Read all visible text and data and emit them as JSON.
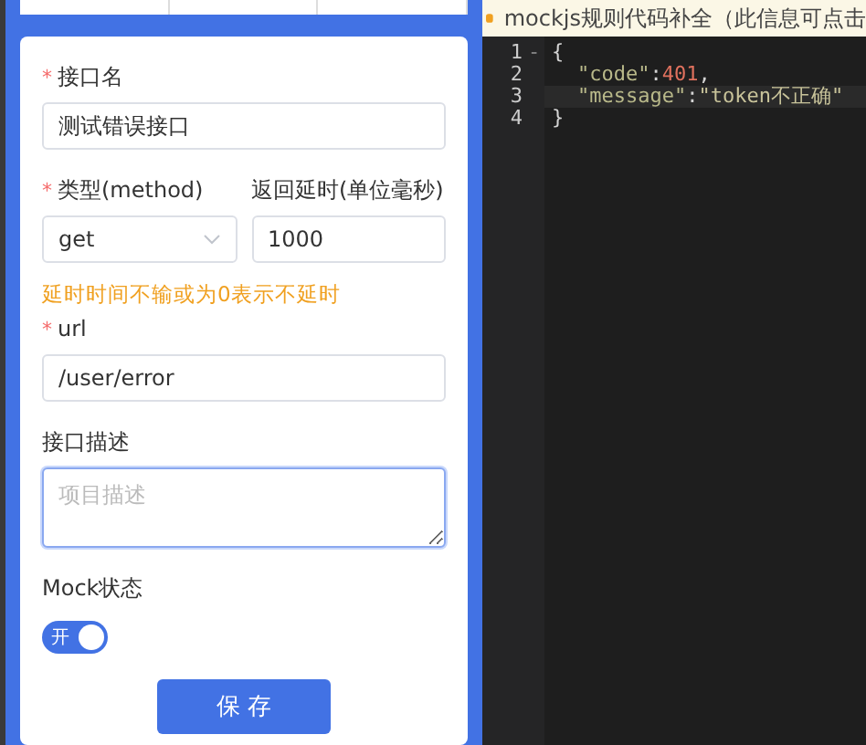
{
  "form": {
    "name": {
      "required_mark": "*",
      "label": "接口名",
      "value": "测试错误接口"
    },
    "method": {
      "required_mark": "*",
      "label": "类型(method)",
      "value": "get"
    },
    "delay": {
      "label": "返回延时(单位毫秒)",
      "value": "1000"
    },
    "hint": "延时时间不输或为0表示不延时",
    "url": {
      "required_mark": "*",
      "label": "url",
      "value": "/user/error"
    },
    "description": {
      "label": "接口描述",
      "placeholder": "项目描述",
      "focused": true
    },
    "mock": {
      "label": "Mock状态",
      "on": true,
      "switch_text": "开"
    },
    "save_button": "保 存"
  },
  "editor": {
    "banner": "mockjs规则代码补全（此信息可点击",
    "lines": [
      {
        "number": "1",
        "fold_marker": "-",
        "highlighted": false,
        "tokens": [
          {
            "text": "{",
            "kind": "punct"
          }
        ]
      },
      {
        "number": "2",
        "highlighted": false,
        "indented": true,
        "tokens": [
          {
            "text": "\"code\"",
            "kind": "key"
          },
          {
            "text": ":",
            "kind": "punct"
          },
          {
            "text": "401",
            "kind": "number"
          },
          {
            "text": ",",
            "kind": "punct"
          }
        ]
      },
      {
        "number": "3",
        "highlighted": true,
        "indented": true,
        "tokens": [
          {
            "text": "\"message\"",
            "kind": "key"
          },
          {
            "text": ":",
            "kind": "punct"
          },
          {
            "text": "\"token不正确\"",
            "kind": "string"
          }
        ]
      },
      {
        "number": "4",
        "highlighted": false,
        "tokens": [
          {
            "text": "}",
            "kind": "punct"
          }
        ]
      }
    ]
  }
}
